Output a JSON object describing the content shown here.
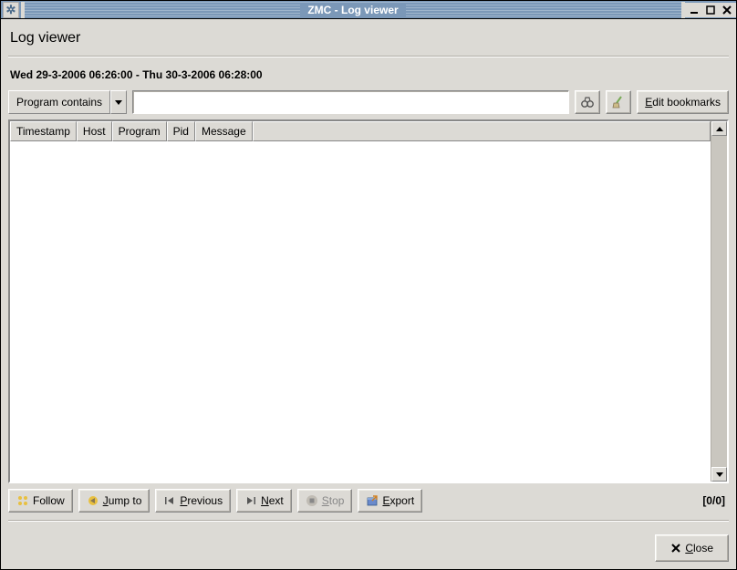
{
  "window": {
    "title": "ZMC - Log viewer"
  },
  "header": {
    "page_title": "Log viewer",
    "date_range": "Wed 29-3-2006 06:26:00 - Thu 30-3-2006 06:28:00"
  },
  "filter": {
    "mode_label": "Program contains",
    "input_value": "",
    "edit_bookmarks_label": "Edit bookmarks"
  },
  "table": {
    "columns": [
      "Timestamp",
      "Host",
      "Program",
      "Pid",
      "Message"
    ],
    "rows": []
  },
  "actions": {
    "follow": "Follow",
    "jump_to": "Jump to",
    "previous": "Previous",
    "next": "Next",
    "stop": "Stop",
    "export": "Export",
    "counter": "[0/0]"
  },
  "footer": {
    "close": "Close"
  }
}
